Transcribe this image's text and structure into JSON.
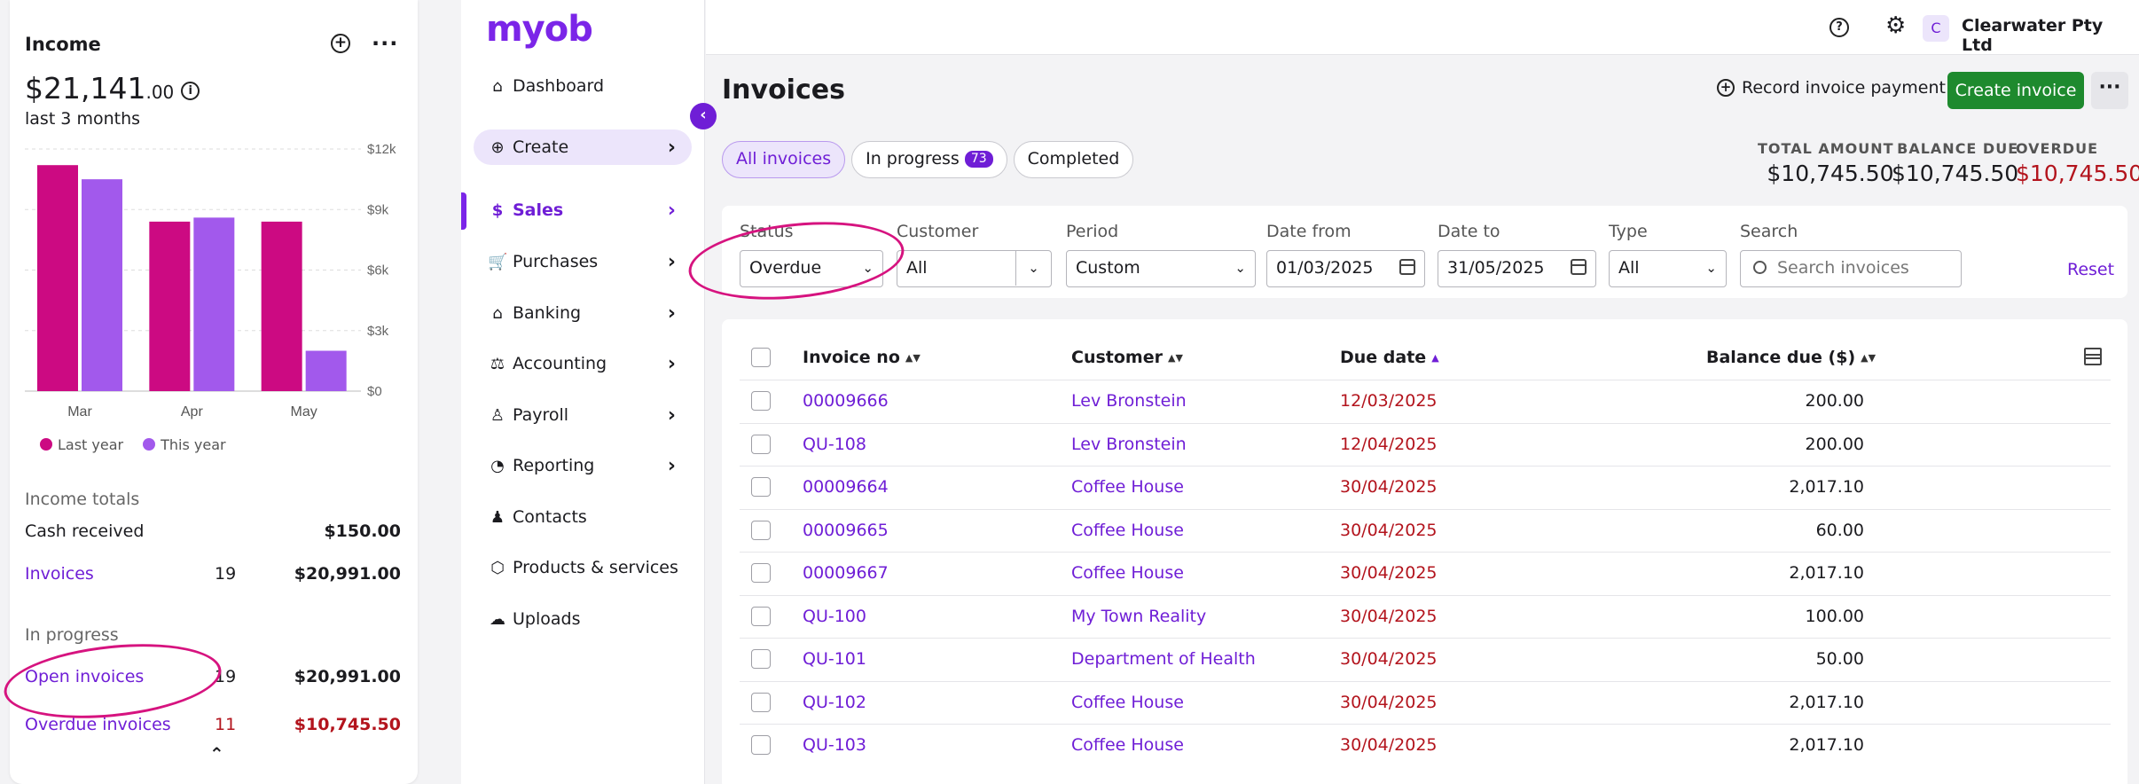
{
  "widget": {
    "title": "Income",
    "amount_main": "$21,141",
    "amount_cents": ".00",
    "period": "last 3 months",
    "legend": {
      "last_year": "Last year",
      "this_year": "This year"
    },
    "income_totals_label": "Income totals",
    "cash_received_label": "Cash received",
    "cash_received_value": "$150.00",
    "invoices_label": "Invoices",
    "invoices_count": "19",
    "invoices_value": "$20,991.00",
    "in_progress_label": "In progress",
    "open_invoices_label": "Open invoices",
    "open_invoices_count": "19",
    "open_invoices_value": "$20,991.00",
    "overdue_invoices_label": "Overdue invoices",
    "overdue_invoices_count": "11",
    "overdue_invoices_value": "$10,745.50"
  },
  "chart_data": {
    "type": "bar",
    "categories": [
      "Mar",
      "Apr",
      "May"
    ],
    "series": [
      {
        "name": "Last year",
        "values": [
          11200,
          8400,
          8400
        ],
        "color": "#cc0a82"
      },
      {
        "name": "This year",
        "values": [
          10500,
          8600,
          2000
        ],
        "color": "#a259ec"
      }
    ],
    "yticks": [
      "$12k",
      "$9k",
      "$6k",
      "$3k",
      "$0"
    ],
    "ylim": [
      0,
      12000
    ],
    "grid": true,
    "legend_position": "bottom-left"
  },
  "nav": {
    "logo": "myob",
    "items": [
      {
        "label": "Dashboard",
        "icon": "home-icon",
        "glyph": "⌂"
      },
      {
        "label": "Create",
        "icon": "plus-circle-icon",
        "glyph": "⊕"
      },
      {
        "label": "Sales",
        "icon": "dollar-circle-icon",
        "glyph": "$"
      },
      {
        "label": "Purchases",
        "icon": "cart-icon",
        "glyph": "🛒"
      },
      {
        "label": "Banking",
        "icon": "bank-icon",
        "glyph": "⌂"
      },
      {
        "label": "Accounting",
        "icon": "scales-icon",
        "glyph": "⚖"
      },
      {
        "label": "Payroll",
        "icon": "person-icon",
        "glyph": "♙"
      },
      {
        "label": "Reporting",
        "icon": "pie-chart-icon",
        "glyph": "◔"
      },
      {
        "label": "Contacts",
        "icon": "people-icon",
        "glyph": "♟"
      },
      {
        "label": "Products & services",
        "icon": "box-icon",
        "glyph": "⬡"
      },
      {
        "label": "Uploads",
        "icon": "cloud-upload-icon",
        "glyph": "☁"
      }
    ]
  },
  "topbar": {
    "help": "?",
    "avatar_letter": "C",
    "company": "Clearwater Pty Ltd"
  },
  "main": {
    "title": "Invoices",
    "record_payment": "Record invoice payment",
    "create_invoice": "Create invoice",
    "tabs": {
      "all": "All invoices",
      "in_progress": "In progress",
      "in_progress_count": "73",
      "completed": "Completed"
    },
    "totals": {
      "total_label": "TOTAL AMOUNT",
      "total_value": "$10,745.50",
      "balance_label": "BALANCE DUE",
      "balance_value": "$10,745.50",
      "overdue_label": "OVERDUE",
      "overdue_value": "$10,745.50"
    },
    "filters": {
      "status_label": "Status",
      "status_value": "Overdue",
      "customer_label": "Customer",
      "customer_value": "All",
      "period_label": "Period",
      "period_value": "Custom",
      "date_from_label": "Date from",
      "date_from_value": "01/03/2025",
      "date_to_label": "Date to",
      "date_to_value": "31/05/2025",
      "type_label": "Type",
      "type_value": "All",
      "search_label": "Search",
      "search_placeholder": "Search invoices",
      "reset": "Reset"
    },
    "table": {
      "headers": {
        "invoice_no": "Invoice no",
        "customer": "Customer",
        "due_date": "Due date",
        "balance_due": "Balance due ($)"
      },
      "rows": [
        {
          "invoice": "00009666",
          "customer": "Lev Bronstein",
          "due": "12/03/2025",
          "balance": "200.00"
        },
        {
          "invoice": "QU-108",
          "customer": "Lev Bronstein",
          "due": "12/04/2025",
          "balance": "200.00"
        },
        {
          "invoice": "00009664",
          "customer": "Coffee House",
          "due": "30/04/2025",
          "balance": "2,017.10"
        },
        {
          "invoice": "00009665",
          "customer": "Coffee House",
          "due": "30/04/2025",
          "balance": "60.00"
        },
        {
          "invoice": "00009667",
          "customer": "Coffee House",
          "due": "30/04/2025",
          "balance": "2,017.10"
        },
        {
          "invoice": "QU-100",
          "customer": "My Town Reality",
          "due": "30/04/2025",
          "balance": "100.00"
        },
        {
          "invoice": "QU-101",
          "customer": "Department of Health",
          "due": "30/04/2025",
          "balance": "50.00"
        },
        {
          "invoice": "QU-102",
          "customer": "Coffee House",
          "due": "30/04/2025",
          "balance": "2,017.10"
        },
        {
          "invoice": "QU-103",
          "customer": "Coffee House",
          "due": "30/04/2025",
          "balance": "2,017.10"
        }
      ]
    }
  },
  "colors": {
    "brand": "#7b25e8",
    "link": "#6f1ed6",
    "overdue": "#b3141d",
    "create_button": "#1e8a2e",
    "annotation": "#d6137f"
  }
}
